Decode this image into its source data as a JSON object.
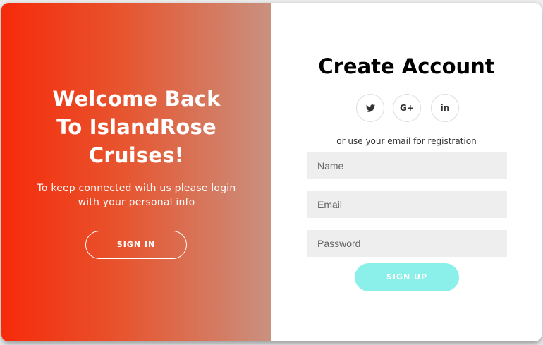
{
  "overlay": {
    "title_line1": "Welcome Back",
    "title_line2": "To IslandRose",
    "title_line3": "Cruises!",
    "message_line1": "To keep connected with us please login",
    "message_line2": "with your personal info",
    "signin_label": "SIGN IN"
  },
  "form": {
    "title": "Create Account",
    "socials": [
      {
        "icon": "twitter-icon"
      },
      {
        "icon": "google-plus-icon",
        "text": "G+"
      },
      {
        "icon": "linkedin-icon",
        "text": "in"
      }
    ],
    "hint": "or use your email for registration",
    "name_placeholder": "Name",
    "email_placeholder": "Email",
    "password_placeholder": "Password",
    "signup_label": "SIGN UP"
  },
  "colors": {
    "gradient_start": "#f62a0a",
    "gradient_end": "#c99180",
    "signup_button": "#8cf0ea",
    "field_background": "#eeeeee"
  }
}
